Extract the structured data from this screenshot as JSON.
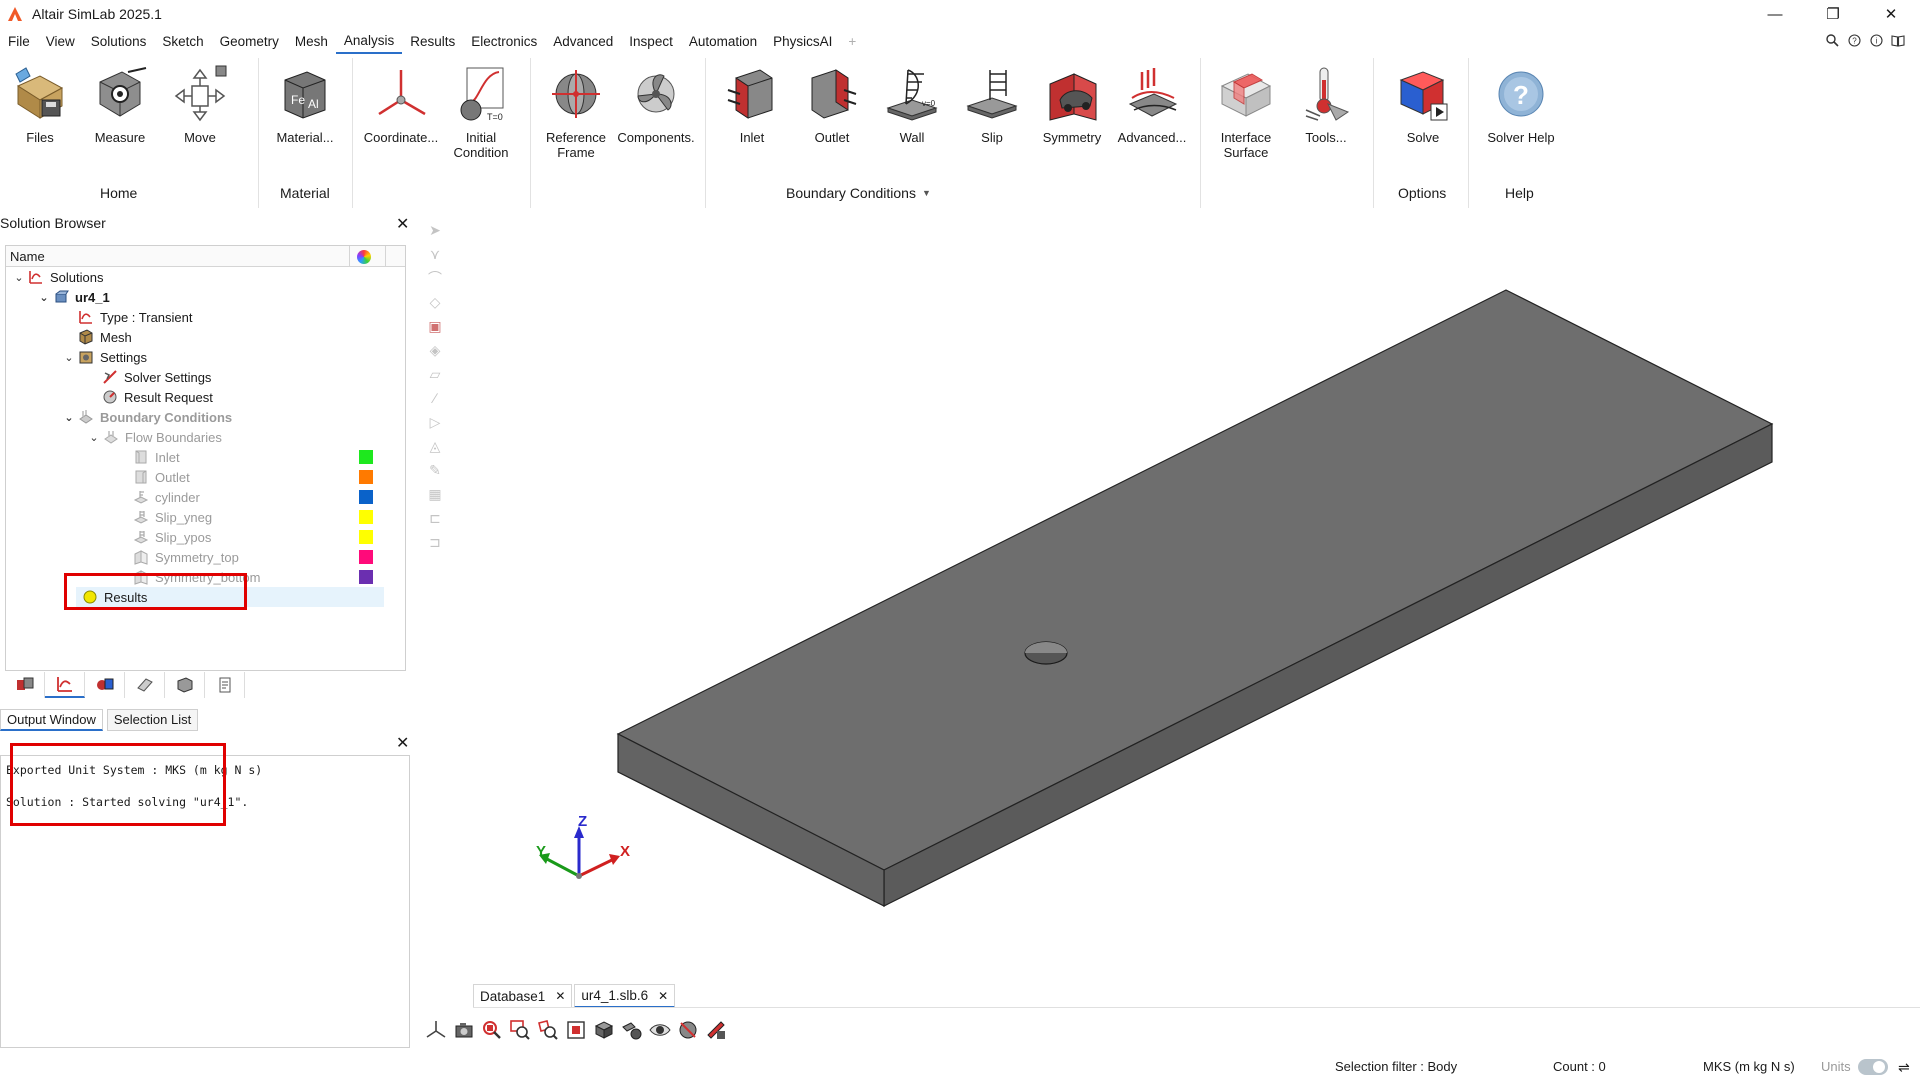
{
  "window": {
    "title": "Altair SimLab 2025.1",
    "controls": [
      "—",
      "❐",
      "✕"
    ]
  },
  "menu": {
    "items": [
      "File",
      "View",
      "Solutions",
      "Sketch",
      "Geometry",
      "Mesh",
      "Analysis",
      "Results",
      "Electronics",
      "Advanced",
      "Inspect",
      "Automation",
      "PhysicsAI"
    ],
    "active": "Analysis",
    "plus_glyph": "+"
  },
  "ribbon": {
    "items": {
      "files": "Files",
      "measure": "Measure",
      "move": "Move",
      "material": "Material...",
      "coordinate": "Coordinate...",
      "initial_condition_l1": "Initial",
      "initial_condition_l2": "Condition",
      "reference_frame_l1": "Reference",
      "reference_frame_l2": "Frame",
      "components": "Components.",
      "inlet": "Inlet",
      "outlet": "Outlet",
      "wall": "Wall",
      "slip": "Slip",
      "symmetry": "Symmetry",
      "advanced": "Advanced...",
      "interface_surface_l1": "Interface",
      "interface_surface_l2": "Surface",
      "tools": "Tools...",
      "solve": "Solve",
      "solver_help": "Solver Help"
    },
    "groups": {
      "home": "Home",
      "material": "Material",
      "boundary_conditions": "Boundary Conditions",
      "options": "Options",
      "help": "Help"
    },
    "icon_text": {
      "material_fe": "Fe",
      "material_al": "Al",
      "initial_t0": "T=0",
      "wall_v0": "v=0",
      "help_q": "?"
    }
  },
  "solution_browser": {
    "title": "Solution Browser",
    "column_name": "Name",
    "tree": {
      "solutions": "Solutions",
      "ur4_1": "ur4_1",
      "type": "Type : Transient",
      "mesh": "Mesh",
      "settings": "Settings",
      "solver_settings": "Solver Settings",
      "result_request": "Result Request",
      "boundary_conditions": "Boundary Conditions",
      "flow_boundaries": "Flow Boundaries",
      "inlet": "Inlet",
      "outlet": "Outlet",
      "cylinder": "cylinder",
      "slip_yneg": "Slip_yneg",
      "slip_ypos": "Slip_ypos",
      "symmetry_top": "Symmetry_top",
      "symmetry_bottom": "Symmetry_bottom",
      "results": "Results"
    },
    "swatch_colors": {
      "inlet": "#1ee81e",
      "outlet": "#ff7a00",
      "cylinder": "#0a62c9",
      "slip_yneg": "#ffff00",
      "slip_ypos": "#ffff00",
      "symmetry_top": "#ff0a7a",
      "symmetry_bottom": "#6b2fb0"
    }
  },
  "output": {
    "tabs": [
      "Output Window",
      "Selection List"
    ],
    "active_tab": "Output Window",
    "lines": [
      "Exported Unit System : MKS (m kg N s)",
      "Solution : Started solving \"ur4_1\"."
    ]
  },
  "viewport": {
    "axis_z": "Z",
    "axis_y": "Y",
    "axis_x": "X",
    "model_color": "#6e6e6e"
  },
  "doc_tabs": [
    {
      "label": "Database1",
      "close": "✕"
    },
    {
      "label": "ur4_1.slb.6",
      "close": "✕"
    }
  ],
  "status": {
    "selection_filter": "Selection filter : Body",
    "count": "Count : 0",
    "unit_system": "MKS (m kg N s)",
    "units_label": "Units"
  },
  "close_glyph": "✕"
}
